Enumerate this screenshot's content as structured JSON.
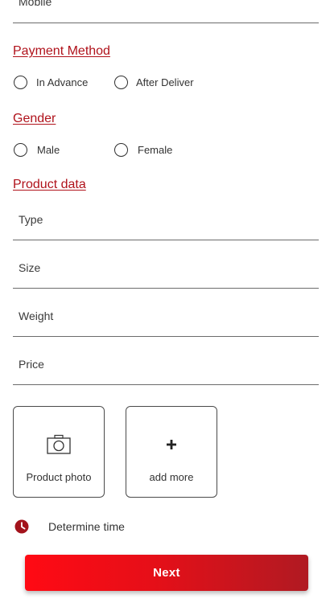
{
  "form": {
    "mobile_label": "Mobile",
    "payment": {
      "title": "Payment Method",
      "options": [
        "In Advance",
        "After Deliver"
      ],
      "selected": null
    },
    "gender": {
      "title": "Gender",
      "options": [
        "Male",
        "Female"
      ],
      "selected": null
    },
    "product": {
      "title": "Product data",
      "fields": [
        "Type",
        "Size",
        "Weight",
        "Price"
      ]
    },
    "photo_label": "Product photo",
    "add_more_label": "add more",
    "time_label": "Determine time",
    "next_label": "Next"
  },
  "icons": {
    "photo": "camera-icon",
    "add": "plus-icon",
    "time": "clock-icon"
  },
  "colors": {
    "accent": "#b0121b",
    "button_start": "#ff0a14",
    "button_end": "#b01a22",
    "line": "#6b6b6b"
  }
}
